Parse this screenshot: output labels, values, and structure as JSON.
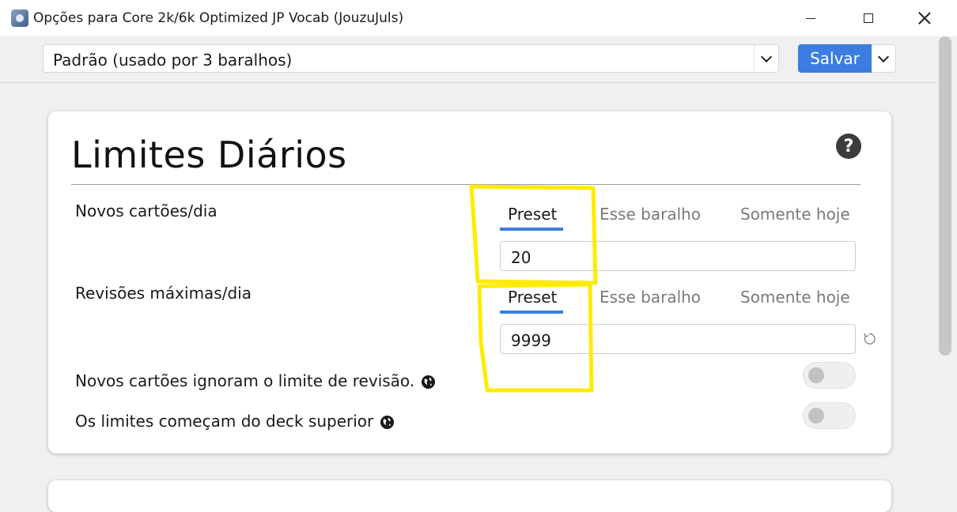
{
  "window": {
    "title": "Opções para Core 2k/6k Optimized JP Vocab (JouzuJuls)",
    "icon": "anki-app-icon"
  },
  "toolbar": {
    "preset_value": "Padrão (usado por 3 baralhos)",
    "save_label": "Salvar"
  },
  "daily_limits": {
    "title": "Limites Diários",
    "help_label": "?",
    "new_cards": {
      "label": "Novos cartões/dia",
      "tabs": [
        "Preset",
        "Esse baralho",
        "Somente hoje"
      ],
      "active_tab": "Preset",
      "value": "20"
    },
    "max_reviews": {
      "label": "Revisões máximas/dia",
      "tabs": [
        "Preset",
        "Esse baralho",
        "Somente hoje"
      ],
      "active_tab": "Preset",
      "value": "9999"
    },
    "new_ignore_review_limit": {
      "label": "Novos cartões ignoram o limite de revisão.",
      "enabled": false
    },
    "limits_start_from_top": {
      "label": "Os limites começam do deck superior",
      "enabled": false
    }
  },
  "colors": {
    "accent": "#3b7de0",
    "highlight": "#ffeb00"
  }
}
